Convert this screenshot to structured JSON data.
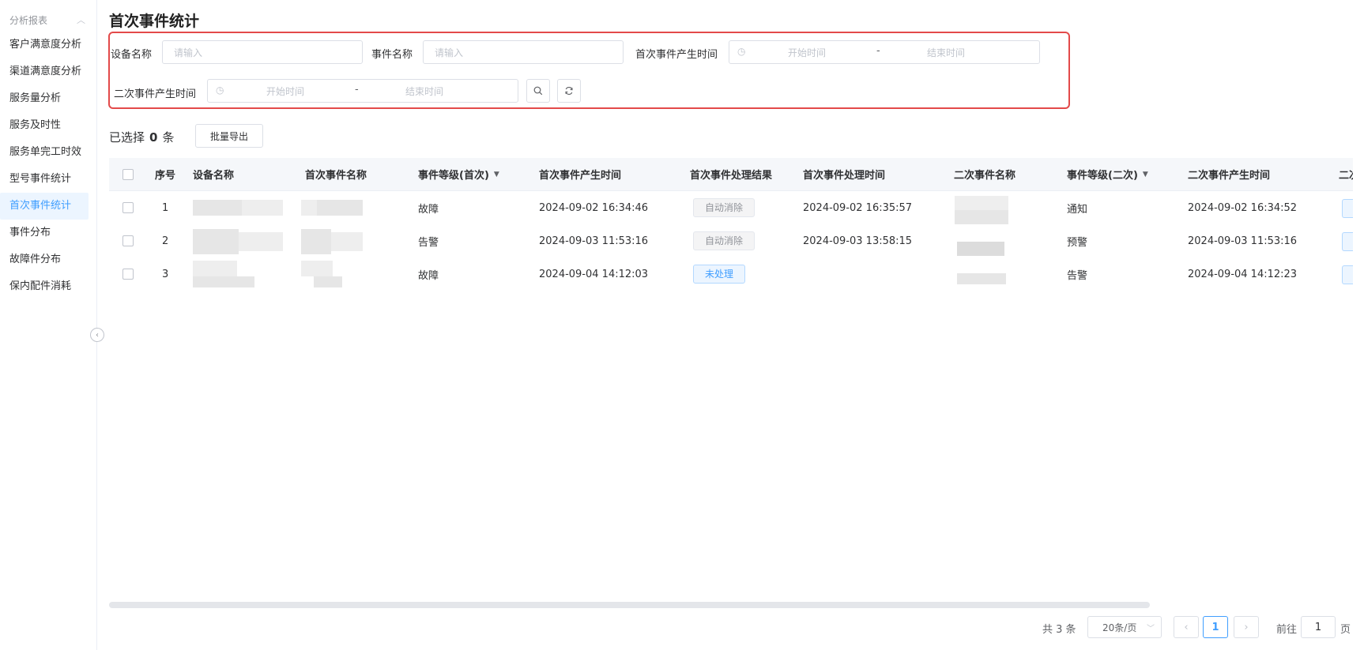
{
  "sidebar": {
    "group_label": "分析报表",
    "items": [
      {
        "label": "客户满意度分析"
      },
      {
        "label": "渠道满意度分析"
      },
      {
        "label": "服务量分析"
      },
      {
        "label": "服务及时性"
      },
      {
        "label": "服务单完工时效"
      },
      {
        "label": "型号事件统计"
      },
      {
        "label": "首次事件统计",
        "active": true
      },
      {
        "label": "事件分布"
      },
      {
        "label": "故障件分布"
      },
      {
        "label": "保内配件消耗"
      }
    ]
  },
  "page_title": "首次事件统计",
  "filters": {
    "device_name_label": "设备名称",
    "device_name_placeholder": "请输入",
    "event_name_label": "事件名称",
    "event_name_placeholder": "请输入",
    "first_time_label": "首次事件产生时间",
    "second_time_label": "二次事件产生时间",
    "start_placeholder": "开始时间",
    "end_placeholder": "结束时间",
    "range_sep": "-"
  },
  "selection": {
    "prefix": "已选择",
    "count": "0",
    "suffix": "条"
  },
  "export_label": "批量导出",
  "table": {
    "headers": {
      "index": "序号",
      "device_name": "设备名称",
      "first_event_name": "首次事件名称",
      "first_level": "事件等级(首次)",
      "first_time": "首次事件产生时间",
      "first_result": "首次事件处理结果",
      "first_handle_time": "首次事件处理时间",
      "second_event_name": "二次事件名称",
      "second_level": "事件等级(二次)",
      "second_time": "二次事件产生时间",
      "cut": "二次"
    },
    "rows": [
      {
        "index": "1",
        "first_level": "故障",
        "first_time": "2024-09-02  16:34:46",
        "first_result": "自动消除",
        "first_handle_time": "2024-09-02  16:35:57",
        "second_level": "通知",
        "second_time": "2024-09-02  16:34:52"
      },
      {
        "index": "2",
        "first_level": "告警",
        "first_time": "2024-09-03  11:53:16",
        "first_result": "自动消除",
        "first_handle_time": "2024-09-03  13:58:15",
        "second_level": "预警",
        "second_time": "2024-09-03  11:53:16"
      },
      {
        "index": "3",
        "first_level": "故障",
        "first_time": "2024-09-04  14:12:03",
        "first_result": "未处理",
        "first_handle_time": "",
        "second_level": "告警",
        "second_time": "2024-09-04  14:12:23"
      }
    ]
  },
  "pagination": {
    "total": "共 3 条",
    "page_size": "20条/页",
    "current_page": "1",
    "goto_label": "前往",
    "goto_value": "1",
    "page_unit": "页"
  },
  "colors": {
    "accent": "#409eff",
    "highlight_border": "#e34a4a"
  }
}
